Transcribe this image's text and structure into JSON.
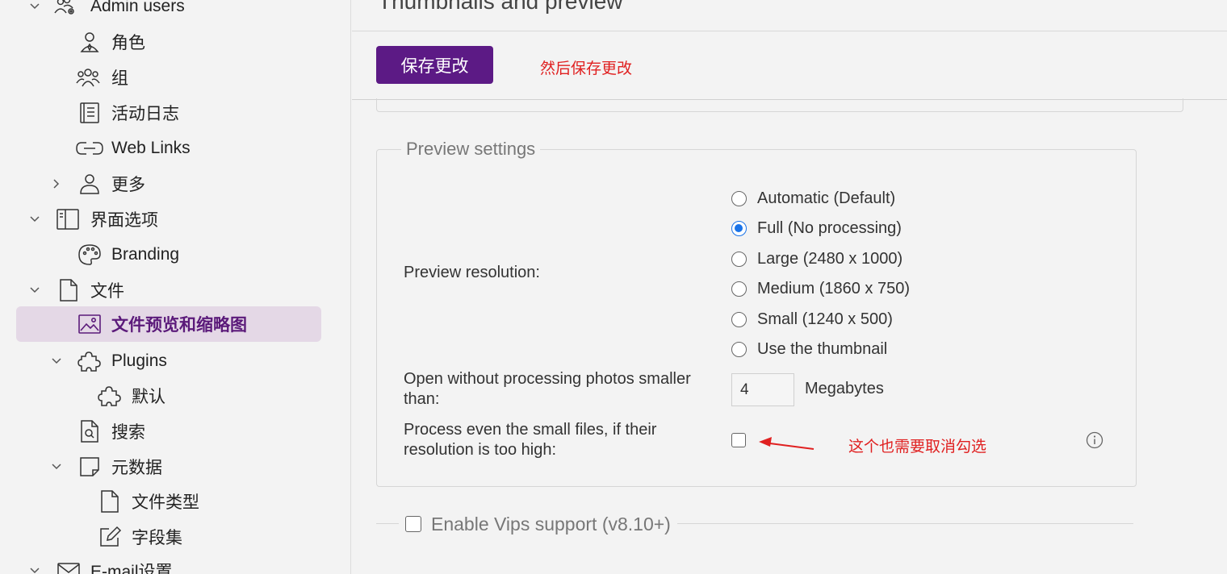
{
  "sidebar": {
    "items": [
      {
        "label": "Admin users",
        "icon": "admin-users-icon"
      },
      {
        "label": "角色",
        "icon": "role-icon"
      },
      {
        "label": "组",
        "icon": "group-icon"
      },
      {
        "label": "活动日志",
        "icon": "activity-log-icon"
      },
      {
        "label": "Web Links",
        "icon": "link-icon"
      },
      {
        "label": "更多",
        "icon": "user-icon"
      },
      {
        "label": "界面选项",
        "icon": "layout-icon"
      },
      {
        "label": "Branding",
        "icon": "palette-icon"
      },
      {
        "label": "文件",
        "icon": "file-icon"
      },
      {
        "label": "文件预览和缩略图",
        "icon": "image-icon",
        "active": true
      },
      {
        "label": "Plugins",
        "icon": "puzzle-icon"
      },
      {
        "label": "默认",
        "icon": "puzzle-icon"
      },
      {
        "label": "搜索",
        "icon": "search-file-icon"
      },
      {
        "label": "元数据",
        "icon": "note-icon"
      },
      {
        "label": "文件类型",
        "icon": "file-icon"
      },
      {
        "label": "字段集",
        "icon": "edit-icon"
      },
      {
        "label": "E-mail设置",
        "icon": "mail-icon"
      }
    ]
  },
  "main": {
    "title": "Thumbnails and preview",
    "save_label": "保存更改",
    "save_annotation": "然后保存更改",
    "preview": {
      "legend": "Preview settings",
      "resolution_label": "Preview resolution:",
      "options": [
        {
          "label": "Automatic (Default)",
          "checked": false
        },
        {
          "label": "Full (No processing)",
          "checked": true
        },
        {
          "label": "Large (2480 x 1000)",
          "checked": false
        },
        {
          "label": "Medium (1860 x 750)",
          "checked": false
        },
        {
          "label": "Small (1240 x 500)",
          "checked": false
        },
        {
          "label": "Use the thumbnail",
          "checked": false
        }
      ],
      "open_without_label_1": "Open without processing photos smaller",
      "open_without_label_2": "than:",
      "open_without_value": "4",
      "open_without_unit": "Megabytes",
      "process_small_label_1": "Process even the small files, if their",
      "process_small_label_2": "resolution is too high:",
      "process_small_checked": false,
      "process_small_annotation": "这个也需要取消勾选"
    },
    "vips_label": "Enable Vips support (v8.10+)",
    "vips_checked": false
  },
  "colors": {
    "accent": "#5c1a85",
    "active_bg": "#e4d8e6",
    "annotation": "#e02020",
    "radio_checked": "#1a73e8"
  }
}
